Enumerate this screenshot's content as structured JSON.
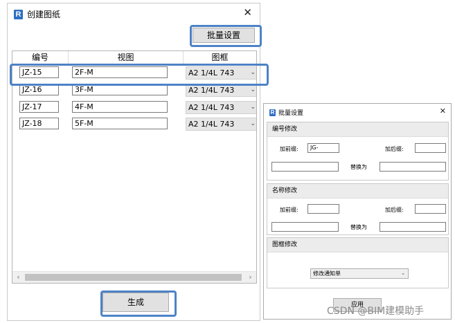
{
  "main_dialog": {
    "title": "创建图纸",
    "batch_button": "批量设置",
    "columns": [
      "编号",
      "视图",
      "图框"
    ],
    "rows": [
      {
        "code": "JZ-15",
        "view": "2F-M",
        "frame": "A2 1/4L 743"
      },
      {
        "code": "JZ-16",
        "view": "3F-M",
        "frame": "A2 1/4L 743"
      },
      {
        "code": "JZ-17",
        "view": "4F-M",
        "frame": "A2 1/4L 743"
      },
      {
        "code": "JZ-18",
        "view": "5F-M",
        "frame": "A2 1/4L 743"
      }
    ],
    "generate_button": "生成"
  },
  "batch_dialog": {
    "title": "批量设置",
    "code_group": {
      "heading": "编号修改",
      "prefix_label": "加前缀:",
      "prefix_value": "JG-",
      "suffix_label": "加后缀:",
      "suffix_value": "",
      "find_value": "",
      "replace_label": "替换为",
      "replace_value": ""
    },
    "name_group": {
      "heading": "名称修改",
      "prefix_label": "加前缀:",
      "prefix_value": "",
      "suffix_label": "加后缀:",
      "suffix_value": "",
      "find_value": "",
      "replace_label": "替换为",
      "replace_value": ""
    },
    "frame_group": {
      "heading": "图框修改",
      "selected": "修改通知单"
    },
    "apply_button": "应用"
  },
  "watermark": "CSDN @BIM建模助手",
  "icons": {
    "app_logo": "R",
    "close": "✕",
    "dropdown": "⌄",
    "scroll_left": "‹",
    "scroll_right": "›"
  },
  "colors": {
    "highlight": "#4d82c6",
    "logo_blue": "#2f6fc4",
    "button_face": "#e1e1e1"
  }
}
